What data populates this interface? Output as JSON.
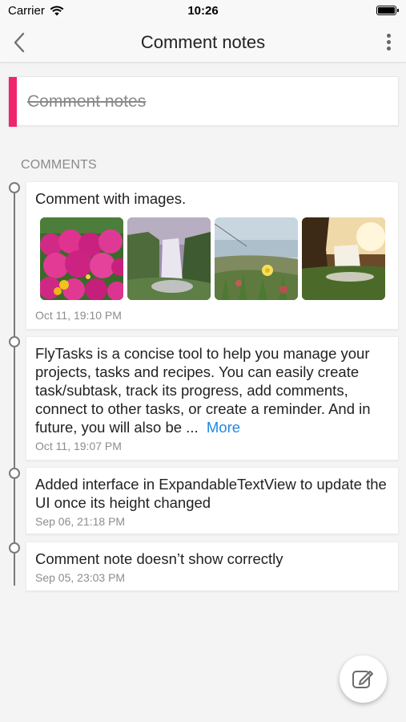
{
  "status_bar": {
    "carrier": "Carrier",
    "time": "10:26"
  },
  "nav": {
    "title": "Comment notes",
    "back_icon": "chevron-left-icon",
    "menu_icon": "more-vertical-icon"
  },
  "note": {
    "title": "Comment notes",
    "accent_color": "#f0246e",
    "completed": true
  },
  "section": {
    "label": "COMMENTS"
  },
  "comments": [
    {
      "text": "Comment with images.",
      "time": "Oct 11, 19:10 PM",
      "images": [
        "flowers-photo",
        "waterfall-photo",
        "seaside-flower-photo",
        "waterfall-sunset-photo"
      ]
    },
    {
      "text": "FlyTasks is a concise tool to help you manage your projects, tasks and recipes.  You can easily create task/subtask, track its progress, add comments, connect to other tasks, or create a reminder. And in future, you will also be ...",
      "more_label": "More",
      "time": "Oct 11, 19:07 PM"
    },
    {
      "text": "Added interface in ExpandableTextView to update the UI once its height changed",
      "time": "Sep 06, 21:18 PM"
    },
    {
      "text": "Comment note doesn’t show correctly",
      "time": "Sep 05, 23:03 PM"
    }
  ],
  "fab": {
    "icon": "edit-note-icon"
  },
  "colors": {
    "accent": "#f0246e",
    "link": "#1e88e5",
    "timeline": "#7a7a7a"
  }
}
